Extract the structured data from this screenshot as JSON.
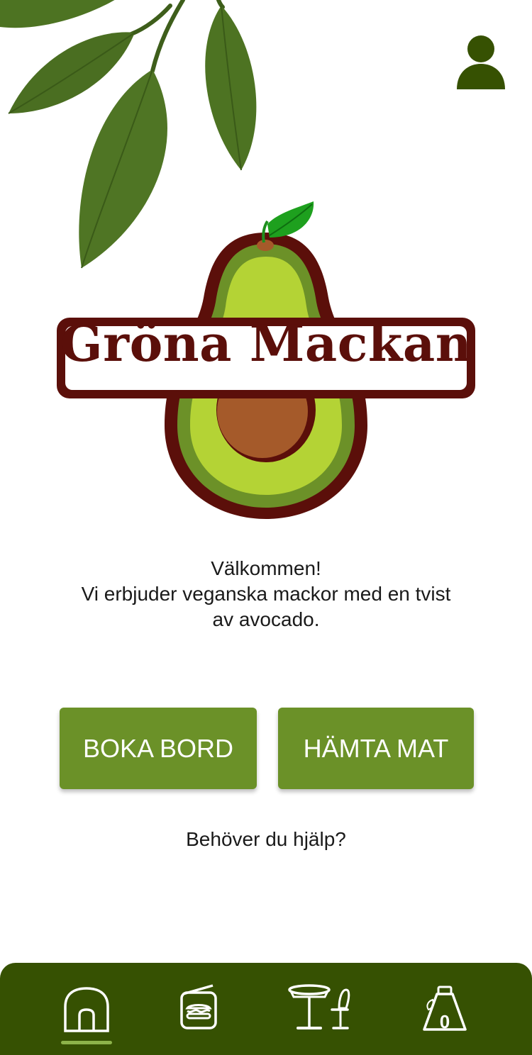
{
  "brand": {
    "name": "Gröna Mackan"
  },
  "welcome": {
    "line1": "Välkommen!",
    "line2": "Vi erbjuder veganska mackor med en tvist",
    "line3": "av avocado."
  },
  "actions": {
    "book_table": "BOKA BORD",
    "pickup_food": "HÄMTA MAT"
  },
  "help": {
    "label": "Behöver du hjälp?"
  },
  "nav": {
    "items": [
      {
        "icon": "home-icon",
        "active": true
      },
      {
        "icon": "sandwich-menu-icon",
        "active": false
      },
      {
        "icon": "table-chair-icon",
        "active": false
      },
      {
        "icon": "cart-bag-icon",
        "active": false
      }
    ],
    "cart_count": "0"
  },
  "colors": {
    "accent": "#6b9128",
    "navbar": "#365102",
    "brand_text": "#5b0f0a",
    "leaf": "#4a6e21"
  }
}
